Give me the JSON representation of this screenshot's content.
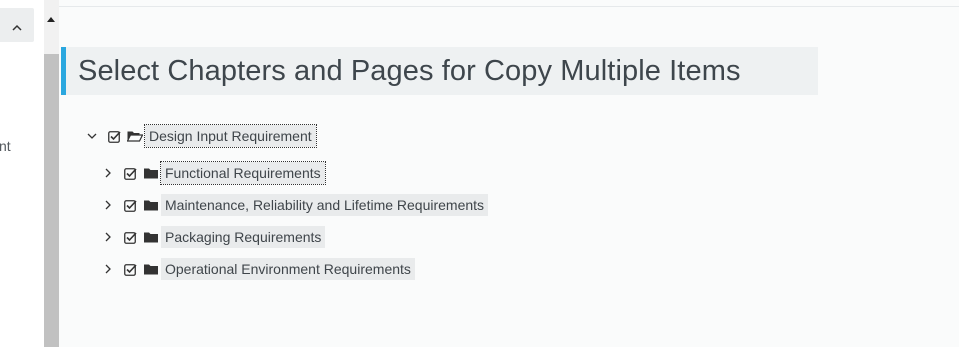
{
  "sidebar": {
    "collapse_icon": "chevron-up-icon",
    "clipped_label_fragment": "nt"
  },
  "scrollbar": {
    "up_icon": "triangle-up-icon"
  },
  "page": {
    "title": "Select Chapters and Pages for Copy Multiple Items"
  },
  "tree": {
    "root": {
      "label": "Design Input Requirement",
      "expanded": true,
      "checked": true,
      "icon": "folder-open-icon"
    },
    "children": [
      {
        "label": "Functional Requirements",
        "checked": true,
        "icon": "folder-icon",
        "focused": true
      },
      {
        "label": "Maintenance, Reliability and Lifetime Requirements",
        "checked": true,
        "icon": "folder-icon"
      },
      {
        "label": "Packaging Requirements",
        "checked": true,
        "icon": "folder-icon"
      },
      {
        "label": "Operational Environment Requirements",
        "checked": true,
        "icon": "folder-icon"
      }
    ]
  },
  "colors": {
    "accent": "#2aa7df",
    "title_bg": "#eef1f2",
    "label_bg": "#e9ebec",
    "text": "#3f454a"
  }
}
